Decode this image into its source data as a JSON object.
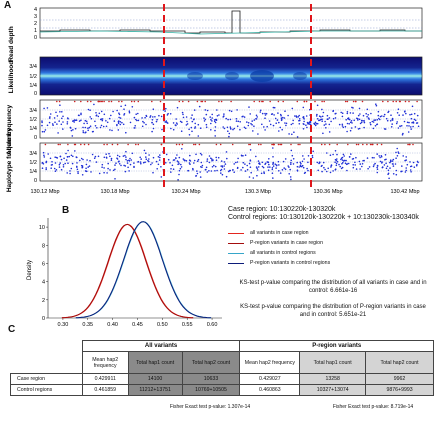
{
  "panels": {
    "a_label": "A",
    "b_label": "B",
    "c_label": "C"
  },
  "panel_a": {
    "y_labels": {
      "read_depth": "Read depth",
      "likelihood": "Likelihood",
      "allele_frequency": "Allele frequency",
      "haplotype_frequency": "Haplotype frequency"
    },
    "read_depth_ticks": [
      "0",
      "1",
      "2",
      "3",
      "4"
    ],
    "frac_ticks": [
      "0",
      "1/4",
      "1/2",
      "3/4"
    ],
    "x_ticks": [
      "130.12 Mbp",
      "130.18 Mbp",
      "130.24 Mbp",
      "130.3 Mbp",
      "130.36 Mbp",
      "130.42 Mbp"
    ],
    "colors": {
      "red_dash": "#e0161b",
      "heat_bg": "#12127a",
      "point_blue": "#1f2fd6",
      "point_red": "#d21f1f"
    }
  },
  "panel_b": {
    "case_region": "Case region: 10:130220k-130320k",
    "control_regions": "Control regions: 10:130120k-130220k + 10:130230k-130340k",
    "legend": [
      {
        "label": "all variants in case region",
        "color": "#e3261f"
      },
      {
        "label": "P-region variants in case region",
        "color": "#a30d0d"
      },
      {
        "label": "all variants in control regions",
        "color": "#36a6c9"
      },
      {
        "label": "P-region variants in control regions",
        "color": "#0c1c7a"
      }
    ],
    "ks_all": "KS-test p-value comparing the distribution of all variants in case and in control: 6.661e-16",
    "ks_p": "KS-test p-value comparing the distribution of P-region variants in case and in control: 5.651e-21",
    "y_axis_label": "Density",
    "y_ticks": [
      "0",
      "2",
      "4",
      "6",
      "8",
      "10"
    ],
    "x_ticks": [
      "0.30",
      "0.35",
      "0.40",
      "0.45",
      "0.50",
      "0.55",
      "0.60"
    ]
  },
  "chart_data": {
    "type": "line",
    "xlim": [
      0.27,
      0.62
    ],
    "ylim": [
      0,
      11
    ],
    "series": [
      {
        "name": "all variants in case region",
        "mean": 0.43,
        "sd": 0.038,
        "peak": 10.3
      },
      {
        "name": "P-region variants in case region",
        "mean": 0.429,
        "sd": 0.038,
        "peak": 10.3
      },
      {
        "name": "all variants in control regions",
        "mean": 0.462,
        "sd": 0.039,
        "peak": 10.6
      },
      {
        "name": "P-region variants in control regions",
        "mean": 0.461,
        "sd": 0.039,
        "peak": 10.6
      }
    ]
  },
  "panel_c": {
    "group_all": "All variants",
    "group_p": "P-region variants",
    "col_mean": "Mean hap2 frequency",
    "col_hap1": "Total hap1 count",
    "col_hap2": "Total hap2 count",
    "rows": [
      {
        "label": "Case region",
        "all": [
          "0.429911",
          "14100",
          "10633"
        ],
        "p": [
          "0.429027",
          "13258",
          "9962"
        ]
      },
      {
        "label": "Control regions",
        "all": [
          "0.461859",
          "11212+13751",
          "10769+10505"
        ],
        "p": [
          "0.460863",
          "10327+13074",
          "9876+9993"
        ]
      }
    ],
    "fisher_all": "Fisher Exact test p-value: 1.307e-14",
    "fisher_p": "Fisher Exact test p-value: 8.719e-14"
  }
}
